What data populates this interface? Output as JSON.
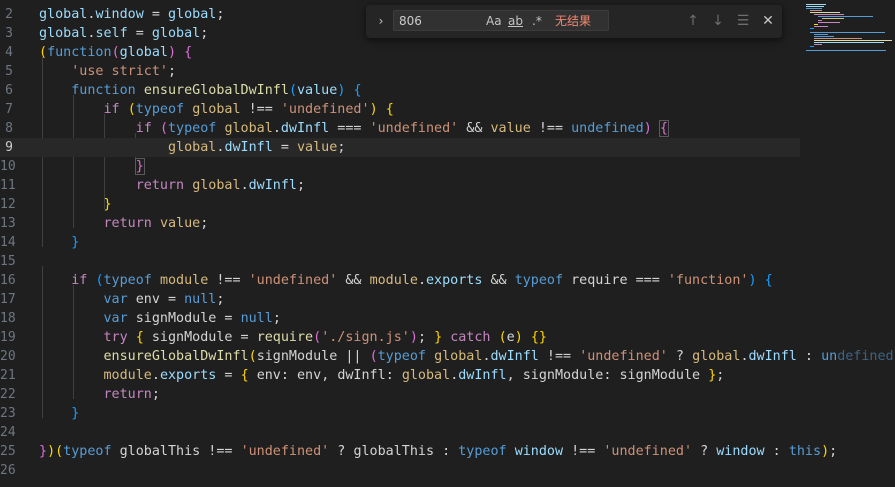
{
  "editor": {
    "current_line": "9",
    "lines": [
      {
        "num": "2",
        "code": "global.window = global;"
      },
      {
        "num": "3",
        "code": "global.self = global;"
      },
      {
        "num": "4",
        "code": "(function(global) {"
      },
      {
        "num": "5",
        "code": "    'use strict';"
      },
      {
        "num": "6",
        "code": "    function ensureGlobalDwInfl(value) {"
      },
      {
        "num": "7",
        "code": "        if (typeof global !== 'undefined') {"
      },
      {
        "num": "8",
        "code": "            if (typeof global.dwInfl === 'undefined' && value !== undefined) {"
      },
      {
        "num": "9",
        "code": "                global.dwInfl = value;"
      },
      {
        "num": "10",
        "code": "            }"
      },
      {
        "num": "11",
        "code": "            return global.dwInfl;"
      },
      {
        "num": "12",
        "code": "        }"
      },
      {
        "num": "13",
        "code": "        return value;"
      },
      {
        "num": "14",
        "code": "    }"
      },
      {
        "num": "15",
        "code": ""
      },
      {
        "num": "16",
        "code": "    if (typeof module !== 'undefined' && module.exports && typeof require === 'function') {"
      },
      {
        "num": "17",
        "code": "        var env = null;"
      },
      {
        "num": "18",
        "code": "        var signModule = null;"
      },
      {
        "num": "19",
        "code": "        try { signModule = require('./sign.js'); } catch (e) {}"
      },
      {
        "num": "20",
        "code": "        ensureGlobalDwInfl(signModule || (typeof global.dwInfl !== 'undefined' ? global.dwInfl : undefined));"
      },
      {
        "num": "21",
        "code": "        module.exports = { env: env, dwInfl: global.dwInfl, signModule: signModule };"
      },
      {
        "num": "22",
        "code": "        return;"
      },
      {
        "num": "23",
        "code": "    }"
      },
      {
        "num": "24",
        "code": ""
      },
      {
        "num": "25",
        "code": "})(typeof globalThis !== 'undefined' ? globalThis : typeof window !== 'undefined' ? window : this);"
      },
      {
        "num": "26",
        "code": ""
      }
    ]
  },
  "find_widget": {
    "toggle_icon": "chevron-right-icon",
    "search_value": "806",
    "match_case_label": "Aa",
    "whole_word_label": "ab",
    "regex_label": ".*",
    "result_text": "无结果",
    "prev_icon": "arrow-up-icon",
    "next_icon": "arrow-down-icon",
    "selection_icon": "find-in-selection-icon",
    "close_icon": "close-icon",
    "result_color": "#f48771"
  },
  "theme": {
    "background": "#1f1f1f",
    "keyword": "#569cd6",
    "control": "#c586c0",
    "function": "#dcdcaa",
    "string": "#ce9178",
    "variable": "#9cdcfe",
    "global": "#d7ba7d"
  }
}
